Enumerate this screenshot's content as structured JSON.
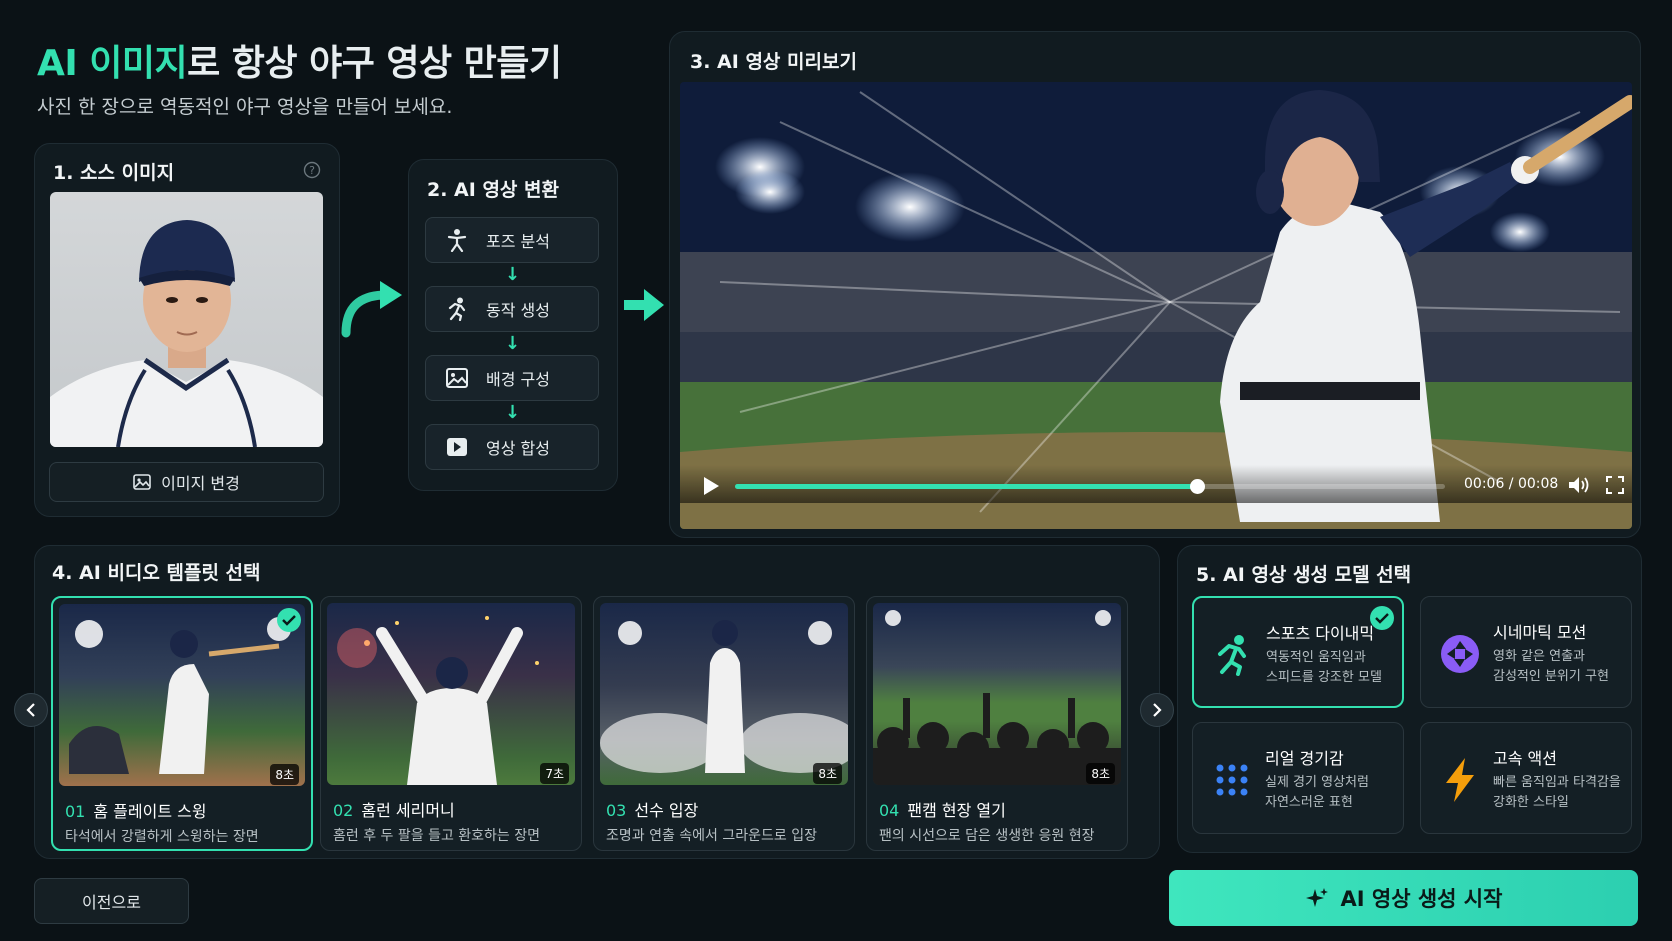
{
  "header": {
    "title_accent": "AI 이미지",
    "title_rest": "로 항상 야구 영상 만들기",
    "subtitle": "사진 한 장으로 역동적인 야구 영상을 만들어 보세요."
  },
  "source": {
    "title": "1. 소스 이미지",
    "change_label": "이미지 변경"
  },
  "convert": {
    "title": "2. AI 영상 변환",
    "steps": [
      {
        "label": "포즈 분석",
        "icon": "pose-icon"
      },
      {
        "label": "동작 생성",
        "icon": "running-icon"
      },
      {
        "label": "배경 구성",
        "icon": "image-icon"
      },
      {
        "label": "영상 합성",
        "icon": "play-icon"
      }
    ]
  },
  "preview": {
    "title": "3. AI 영상 미리보기",
    "time": "00:06 / 00:08",
    "progress": 0.65
  },
  "templates": {
    "title": "4. AI 비디오 템플릿 선택",
    "items": [
      {
        "num": "01",
        "title": "홈 플레이트 스윙",
        "desc": "타석에서 강렬하게 스윙하는 장면",
        "duration": "8초",
        "selected": true
      },
      {
        "num": "02",
        "title": "홈런 세리머니",
        "desc": "홈런 후 두 팔을 들고 환호하는 장면",
        "duration": "7초",
        "selected": false
      },
      {
        "num": "03",
        "title": "선수 입장",
        "desc": "조명과 연출 속에서 그라운드로 입장",
        "duration": "8초",
        "selected": false
      },
      {
        "num": "04",
        "title": "팬캠 현장 열기",
        "desc": "팬의 시선으로 담은 생생한 응원 현장",
        "duration": "8초",
        "selected": false
      }
    ]
  },
  "models": {
    "title": "5. AI 영상 생성 모델 선택",
    "items": [
      {
        "title": "스포츠 다이내믹",
        "desc_line1": "역동적인 움직임과",
        "desc_line2": "스피드를 강조한 모델",
        "icon": "running-icon",
        "color": "#33e0b0",
        "selected": true
      },
      {
        "title": "시네마틱 모션",
        "desc_line1": "영화 같은 연출과",
        "desc_line2": "감성적인 분위기 구현",
        "icon": "aperture-icon",
        "color": "#8a5cf6",
        "selected": false
      },
      {
        "title": "리얼 경기감",
        "desc_line1": "실제 경기 영상처럼",
        "desc_line2": "자연스러운 표현",
        "icon": "dots-grid-icon",
        "color": "#3b82f6",
        "selected": false
      },
      {
        "title": "고속 액션",
        "desc_line1": "빠른 움직임과 타격감을",
        "desc_line2": "강화한 스타일",
        "icon": "lightning-icon",
        "color": "#f59e0b",
        "selected": false
      }
    ]
  },
  "footer": {
    "back_label": "이전으로",
    "cta_label": "AI 영상 생성 시작"
  },
  "colors": {
    "accent": "#33e0b0",
    "background": "#0b1216",
    "panel": "#111b20"
  }
}
